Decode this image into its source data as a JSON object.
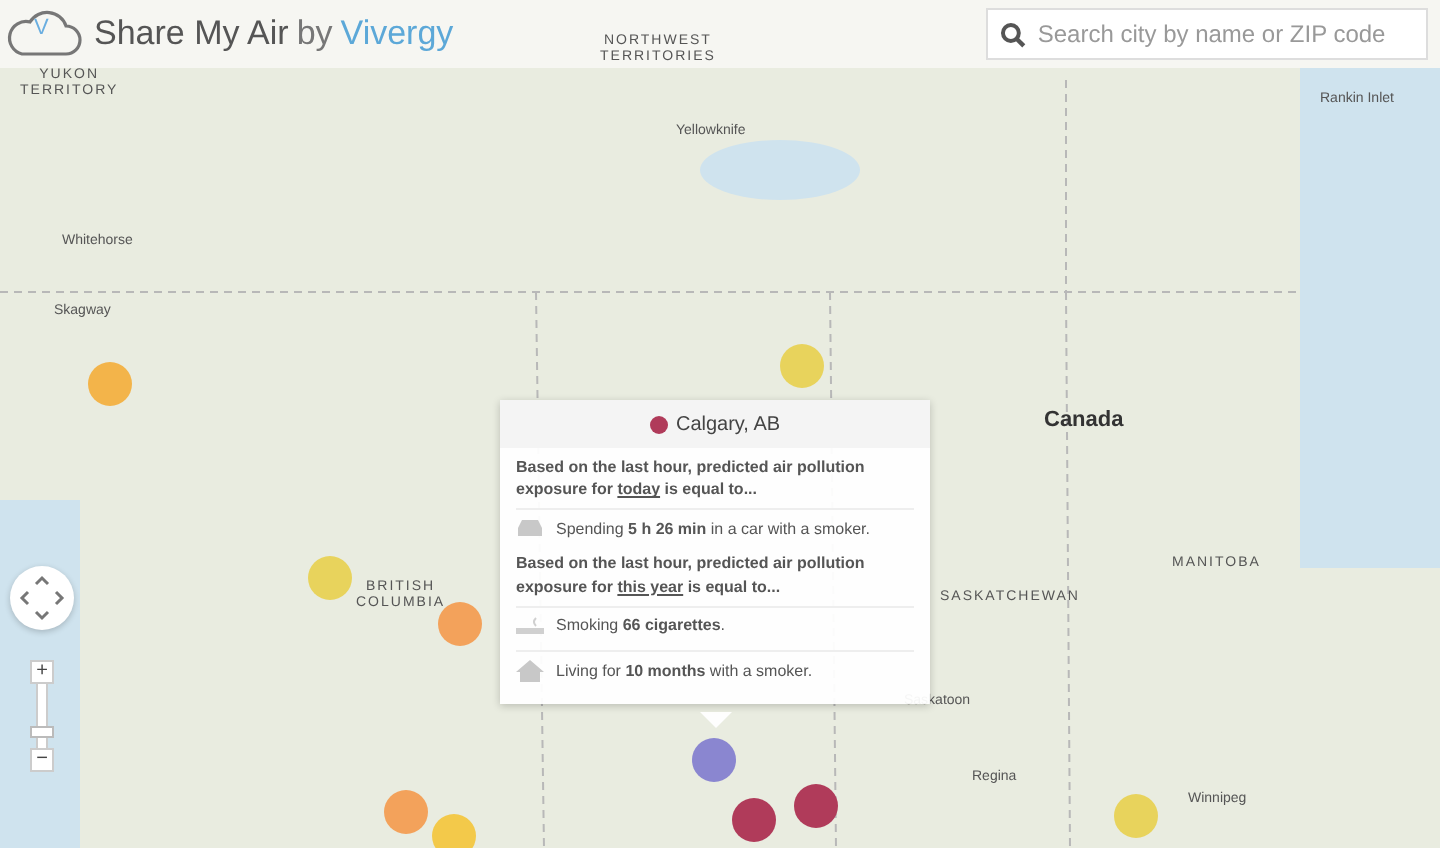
{
  "header": {
    "brand": "Share My Air",
    "by": "by",
    "company": "Vivergy",
    "logo_text": "V"
  },
  "search": {
    "placeholder": "Search city by name or ZIP code"
  },
  "map_labels": [
    {
      "text": "YUKON TERRITORY",
      "kind": "region"
    },
    {
      "text": "NORTHWEST TERRITORIES",
      "kind": "region"
    },
    {
      "text": "Yellowknife",
      "kind": "city"
    },
    {
      "text": "Rankin Inlet",
      "kind": "city"
    },
    {
      "text": "Whitehorse",
      "kind": "city"
    },
    {
      "text": "Skagway",
      "kind": "city"
    },
    {
      "text": "Canada",
      "kind": "country"
    },
    {
      "text": "BRITISH COLUMBIA",
      "kind": "region"
    },
    {
      "text": "SASKATCHEWAN",
      "kind": "region"
    },
    {
      "text": "MANITOBA",
      "kind": "region"
    },
    {
      "text": "Saskatoon",
      "kind": "city"
    },
    {
      "text": "Regina",
      "kind": "city"
    },
    {
      "text": "Winnipeg",
      "kind": "city"
    }
  ],
  "markers": [
    {
      "color": "#f3b44a"
    },
    {
      "color": "#e8d35c"
    },
    {
      "color": "#e8d35c"
    },
    {
      "color": "#f3a25b"
    },
    {
      "color": "#8a86d0"
    },
    {
      "color": "#b03b5a"
    },
    {
      "color": "#b03b5a"
    },
    {
      "color": "#f3a25b"
    },
    {
      "color": "#f3c94a"
    },
    {
      "color": "#e8d35c"
    }
  ],
  "popup": {
    "city": "Calgary, AB",
    "color": "#b03b5a",
    "sections": [
      {
        "before": "Based on the last hour, predicted air pollution exposure for ",
        "emph": "today",
        "after": " is equal to...",
        "items": [
          {
            "kind": "car",
            "text": "Spending **5 h 26 min** in a car with a smoker."
          }
        ]
      },
      {
        "before": "Based on the last hour, predicted air pollution exposure for ",
        "emph": "this year",
        "after": " is equal to...",
        "items": [
          {
            "kind": "cigarette",
            "text": "Smoking **66 cigarettes**."
          },
          {
            "kind": "house",
            "text": "Living for **10 months** with a smoker."
          }
        ]
      }
    ]
  },
  "zoom": {
    "plus": "+",
    "minus": "−",
    "level": 0.15
  }
}
